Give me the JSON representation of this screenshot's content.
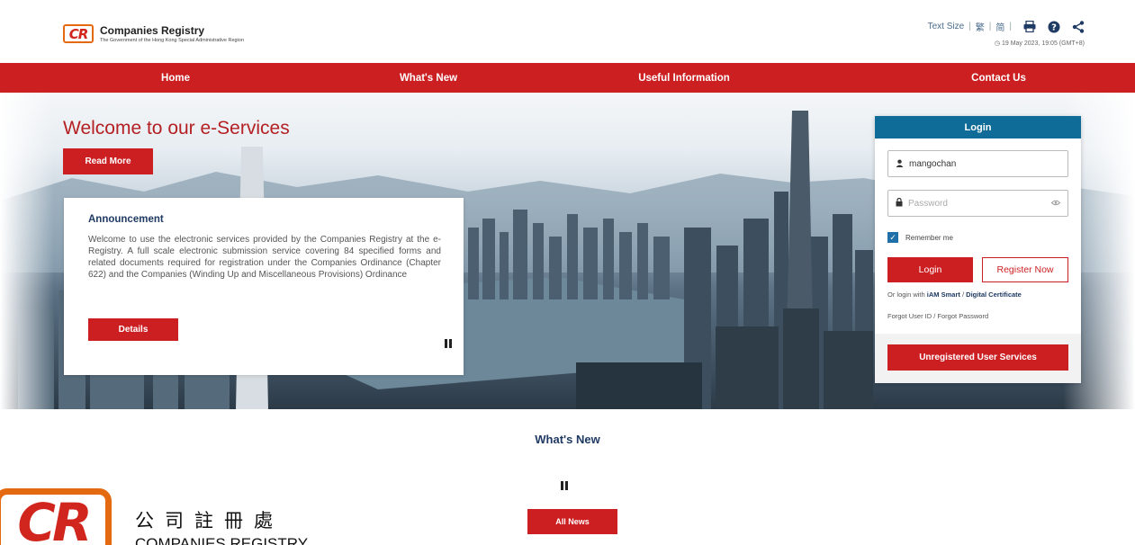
{
  "header": {
    "logo_text": "CR",
    "title": "Companies Registry",
    "subtitle": "The Government of the Hong Kong Special Administrative Region",
    "text_size_label": "Text Size",
    "lang_traditional": "繁",
    "lang_simplified": "简",
    "icons": [
      "print-icon",
      "help-icon",
      "share-icon"
    ],
    "datetime": "19 May 2023, 19:05 (GMT+8)"
  },
  "nav": {
    "items": [
      "Home",
      "What's New",
      "Useful Information",
      "Contact Us"
    ],
    "color": "#cc1f22"
  },
  "hero": {
    "heading": "Welcome to our e-Services",
    "read_more": "Read More",
    "announcement": {
      "title": "Announcement",
      "body": "Welcome to use the electronic services provided by the Companies Registry at the e-Registry. A full scale electronic submission service covering 84 specified forms and related documents required for registration under the Companies Ordinance (Chapter 622) and the Companies (Winding Up and Miscellaneous Provisions) Ordinance",
      "details": "Details"
    }
  },
  "login": {
    "title": "Login",
    "username_value": "mangochan",
    "password_placeholder": "Password",
    "remember_label": "Remember me",
    "remember_checked": true,
    "login_button": "Login",
    "register_button": "Register Now",
    "alt_prefix": "Or login with",
    "alt_iam": "iAM Smart",
    "alt_sep": "/",
    "alt_cert": "Digital Certificate",
    "forgot": "Forgot User ID / Forgot Password",
    "unregistered_button": "Unregistered User Services",
    "header_color": "#0f6b97"
  },
  "whats_new": {
    "title": "What's New",
    "all_news": "All News"
  },
  "footer_logo": {
    "logo_text": "CR",
    "chinese_name": "公司註冊處",
    "english_name": "COMPANIES REGISTRY"
  }
}
